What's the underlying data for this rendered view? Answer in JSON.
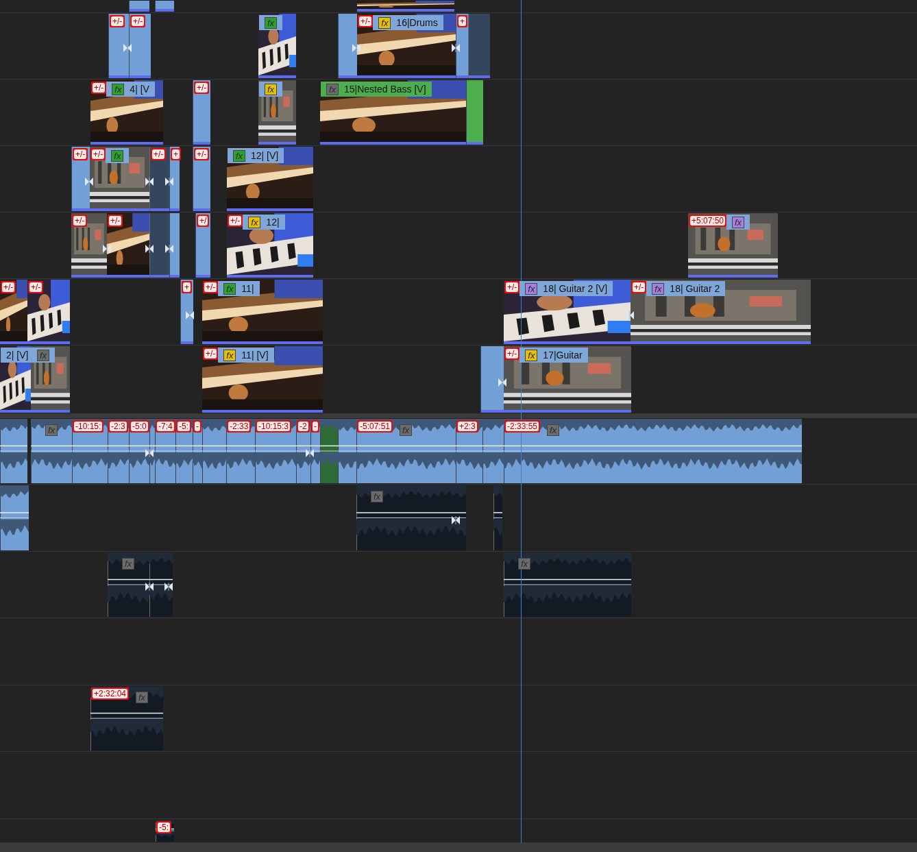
{
  "video_tracks": [
    {
      "clips": [
        {
          "kind": "blank"
        },
        {
          "kind": "blank"
        },
        {
          "kind": "video"
        }
      ]
    },
    {
      "clips": [
        {
          "kind": "blank",
          "envelope": "+/-"
        },
        {
          "kind": "blank",
          "envelope": "+/-"
        },
        {
          "kind": "video",
          "fx": {
            "text": "fx",
            "color": "#2ea02e"
          }
        },
        {
          "kind": "blank"
        },
        {
          "kind": "video",
          "envelope": "+/-",
          "fx": {
            "text": "fx",
            "color": "#e8c000"
          },
          "label": "16|Drums"
        },
        {
          "kind": "blank",
          "envelope": "+"
        },
        {
          "kind": "empty"
        }
      ]
    },
    {
      "clips": [
        {
          "kind": "video",
          "envelope": "+/-",
          "fx": {
            "text": "fx",
            "color": "#2ea02e"
          },
          "label": "4| [V"
        },
        {
          "kind": "blank",
          "envelope": "+/-"
        },
        {
          "kind": "video",
          "fx": {
            "text": "fx",
            "color": "#e8c000"
          }
        },
        {
          "kind": "video",
          "fx": {
            "text": "fx",
            "color": "#6b6b6b"
          },
          "label": "15|Nested Bass [V]",
          "color": "#4cae4c"
        },
        {
          "kind": "blank",
          "color": "#4cae4c"
        }
      ]
    },
    {
      "clips": [
        {
          "kind": "blank",
          "envelope": "+/-"
        },
        {
          "kind": "video",
          "envelope": "+/-",
          "fx": {
            "text": "fx",
            "color": "#2ea02e"
          }
        },
        {
          "kind": "empty",
          "envelope": "+/-"
        },
        {
          "kind": "blank",
          "envelope": "+"
        },
        {
          "kind": "blank",
          "envelope": "+/-"
        },
        {
          "kind": "video",
          "fx": {
            "text": "fx",
            "color": "#2ea02e"
          },
          "label": "12| [V]"
        }
      ]
    },
    {
      "clips": [
        {
          "kind": "video",
          "envelope": "+/-"
        },
        {
          "kind": "video",
          "envelope": "+/-"
        },
        {
          "kind": "empty"
        },
        {
          "kind": "blank"
        },
        {
          "kind": "blank",
          "envelope": "+/"
        },
        {
          "kind": "video",
          "envelope": "+/-",
          "fx": {
            "text": "fx",
            "color": "#e8c000"
          },
          "label": "12|"
        },
        {
          "kind": "video",
          "envelope": "+5:07:50",
          "fx": {
            "text": "fx",
            "color": "#a77fe0"
          }
        }
      ]
    },
    {
      "clips": [
        {
          "kind": "video",
          "envelope": "+/-"
        },
        {
          "kind": "video",
          "envelope": "+/-"
        },
        {
          "kind": "blank",
          "envelope": "+"
        },
        {
          "kind": "video",
          "envelope": "+/-",
          "fx": {
            "text": "fx",
            "color": "#2ea02e"
          },
          "label": "11|"
        },
        {
          "kind": "video",
          "envelope": "+/-",
          "fx": {
            "text": "fx",
            "color": "#a77fe0"
          },
          "label": "18| Guitar 2 [V]"
        },
        {
          "kind": "video",
          "envelope": "+/-",
          "fx": {
            "text": "fx",
            "color": "#a77fe0"
          },
          "label": "18| Guitar 2"
        }
      ]
    },
    {
      "clips": [
        {
          "kind": "video",
          "label": "2| [V]"
        },
        {
          "kind": "video",
          "fx": {
            "text": "fx",
            "color": "#6b6b6b"
          }
        },
        {
          "kind": "video",
          "envelope": "+/-",
          "fx": {
            "text": "fx",
            "color": "#e8c000"
          },
          "label": "11| [V]"
        },
        {
          "kind": "blank"
        },
        {
          "kind": "video",
          "envelope": "+/-",
          "fx": {
            "text": "fx",
            "color": "#e8c000"
          },
          "label": "17|Guitar"
        }
      ]
    }
  ],
  "audio_tracks": [
    {
      "clips": [
        {
          "kind": "audio"
        },
        {
          "kind": "audio",
          "fx": {
            "text": "fx",
            "color": "#6b6b6b"
          }
        },
        {
          "kind": "audio",
          "envelope": "-10:15:"
        },
        {
          "kind": "audio",
          "envelope": "-2:3"
        },
        {
          "kind": "audio",
          "envelope": "-5:0"
        },
        {
          "kind": "audio"
        },
        {
          "kind": "audio",
          "envelope": "-7:4"
        },
        {
          "kind": "audio",
          "envelope": "-5:"
        },
        {
          "kind": "audio",
          "envelope": "-"
        },
        {
          "kind": "audio"
        },
        {
          "kind": "audio",
          "envelope": "-2:33"
        },
        {
          "kind": "audio",
          "envelope": "-10:15:3"
        },
        {
          "kind": "audio",
          "envelope": "-2"
        },
        {
          "kind": "audio",
          "envelope": "-"
        },
        {
          "kind": "audio",
          "color": "#2d6a35"
        },
        {
          "kind": "audio"
        },
        {
          "kind": "audio",
          "envelope": "-5:07:51",
          "fx": {
            "text": "fx",
            "color": "#6b6b6b"
          }
        },
        {
          "kind": "audio",
          "envelope": "+2:3"
        },
        {
          "kind": "audio"
        },
        {
          "kind": "audio",
          "envelope": "-2:33:55",
          "fx": {
            "text": "fx",
            "color": "#6b6b6b"
          }
        }
      ]
    },
    {
      "clips": [
        {
          "kind": "audio"
        },
        {
          "kind": "dark_audio",
          "fx": {
            "text": "fx",
            "color": "#6b6b6b"
          }
        },
        {
          "kind": "dark_audio"
        }
      ]
    },
    {
      "clips": [
        {
          "kind": "dark_audio",
          "fx": {
            "text": "fx",
            "color": "#6b6b6b"
          }
        },
        {
          "kind": "dark_audio"
        },
        {
          "kind": "dark_audio",
          "fx": {
            "text": "fx",
            "color": "#6b6b6b"
          }
        }
      ]
    },
    {
      "clips": [
        {
          "kind": "dark_audio",
          "envelope": "+2:32:04",
          "fx": {
            "text": "fx",
            "color": "#6b6b6b"
          }
        }
      ]
    },
    {
      "clips": [
        {
          "kind": "dark_audio",
          "envelope": "-5:"
        }
      ]
    }
  ]
}
